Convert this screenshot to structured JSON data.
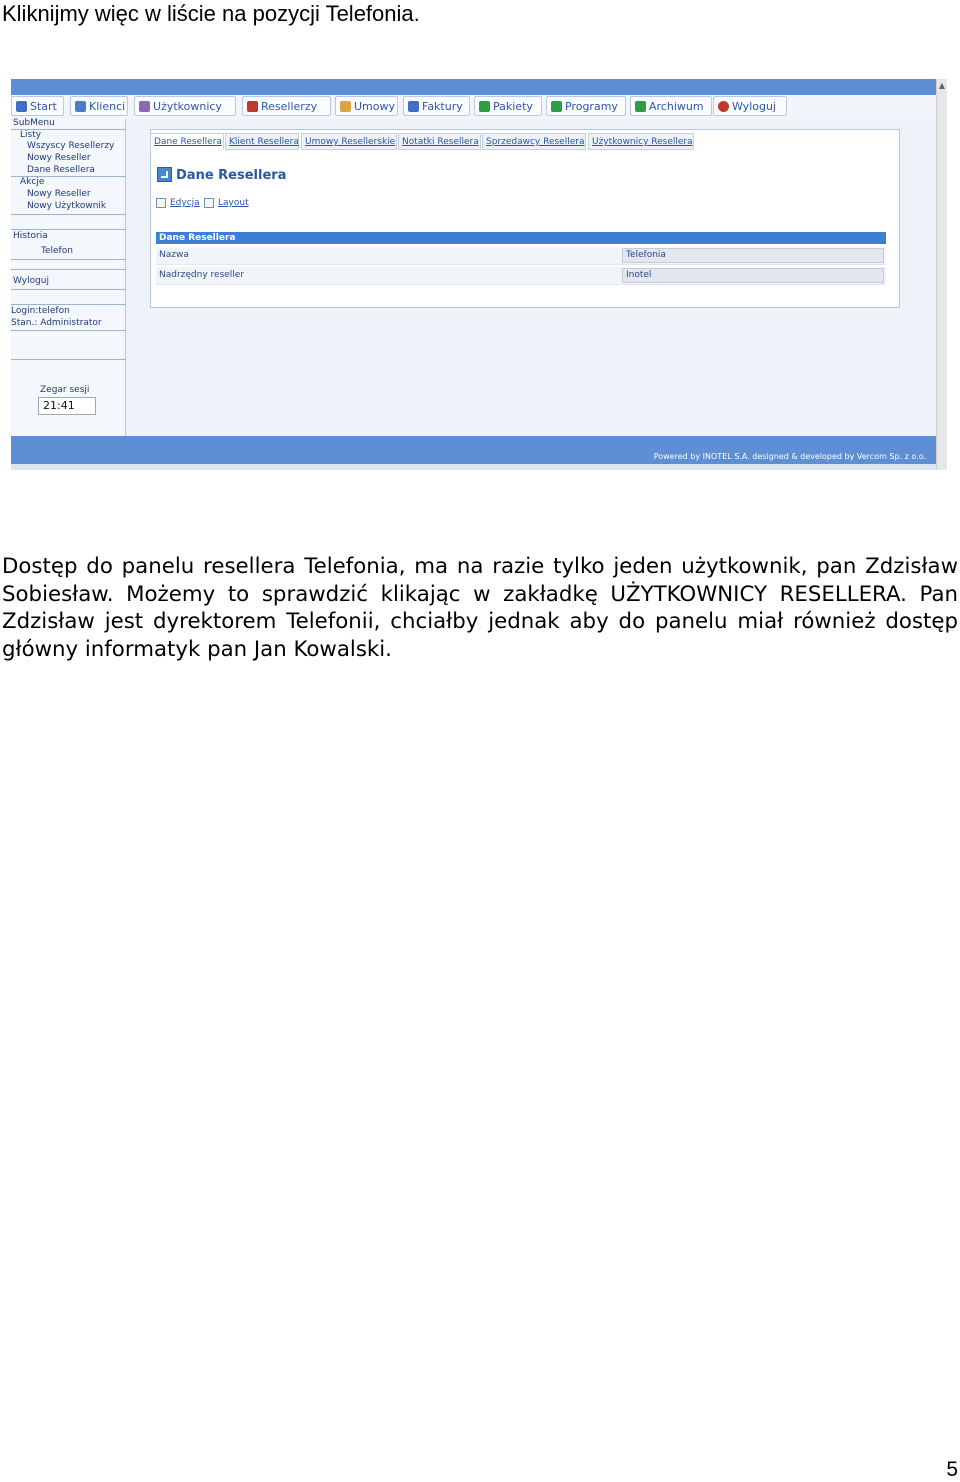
{
  "intro": "Kliknijmy więc w liście na pozycji Telefonia.",
  "paragraph": "Dostęp do panelu resellera Telefonia, ma na razie tylko jeden użytkownik, pan Zdzisław Sobiesław. Możemy to sprawdzić klikając w zakładkę UŻYTKOWNICY RESELLERA. Pan Zdzisław jest dyrektorem Telefonii, chciałby jednak aby do panelu miał również dostęp główny informatyk pan Jan Kowalski.",
  "page_number": "5",
  "screenshot": {
    "menu": [
      {
        "label": "Start",
        "icon": "home-icon",
        "color": "#3f6fc4"
      },
      {
        "label": "Klienci",
        "icon": "clients-icon",
        "color": "#4d7bc9"
      },
      {
        "label": "Użytkownicy",
        "icon": "users-icon",
        "color": "#8a6bb3"
      },
      {
        "label": "Resellerzy",
        "icon": "resellers-icon",
        "color": "#c0392b"
      },
      {
        "label": "Umowy",
        "icon": "contracts-icon",
        "color": "#d9a441"
      },
      {
        "label": "Faktury",
        "icon": "invoices-icon",
        "color": "#3f6fc4"
      },
      {
        "label": "Pakiety",
        "icon": "packages-icon",
        "color": "#2e9e44"
      },
      {
        "label": "Programy",
        "icon": "programs-icon",
        "color": "#2e9e44"
      },
      {
        "label": "Archiwum",
        "icon": "archive-icon",
        "color": "#2e9e44"
      },
      {
        "label": "Wyloguj",
        "icon": "logout-icon",
        "color": "#c0392b"
      }
    ],
    "sidebar": {
      "submenu": "SubMenu",
      "lists": "Listy",
      "all_resellers": "Wszyscy Resellerzy",
      "new_reseller": "Nowy Reseller",
      "reseller_data": "Dane Resellera",
      "actions": "Akcje",
      "new_reseller_2": "Nowy Reseller",
      "new_user": "Nowy Użytkownik",
      "history": "Historia",
      "history_item": "Telefon",
      "logout": "Wyloguj",
      "login": "Login:telefon",
      "status": "Stan.: Administrator",
      "clock_label": "Zegar sesji",
      "clock_value": "21:41"
    },
    "tabs": [
      "Dane Resellera",
      "Klient Resellera",
      "Umowy Resellerskie",
      "Notatki Resellera",
      "Sprzedawcy Resellera",
      "Użytkownicy Resellera"
    ],
    "panel_title": "Dane Resellera",
    "actions": [
      "Edycja",
      "Layout"
    ],
    "table": {
      "header": "Dane Resellera",
      "rows": [
        {
          "label": "Nazwa",
          "value": "Telefonia"
        },
        {
          "label": "Nadrzędny reseller",
          "value": "Inotel"
        }
      ]
    },
    "footer": "Powered by INOTEL S.A. designed & developed by Vercom Sp. z o.o."
  }
}
